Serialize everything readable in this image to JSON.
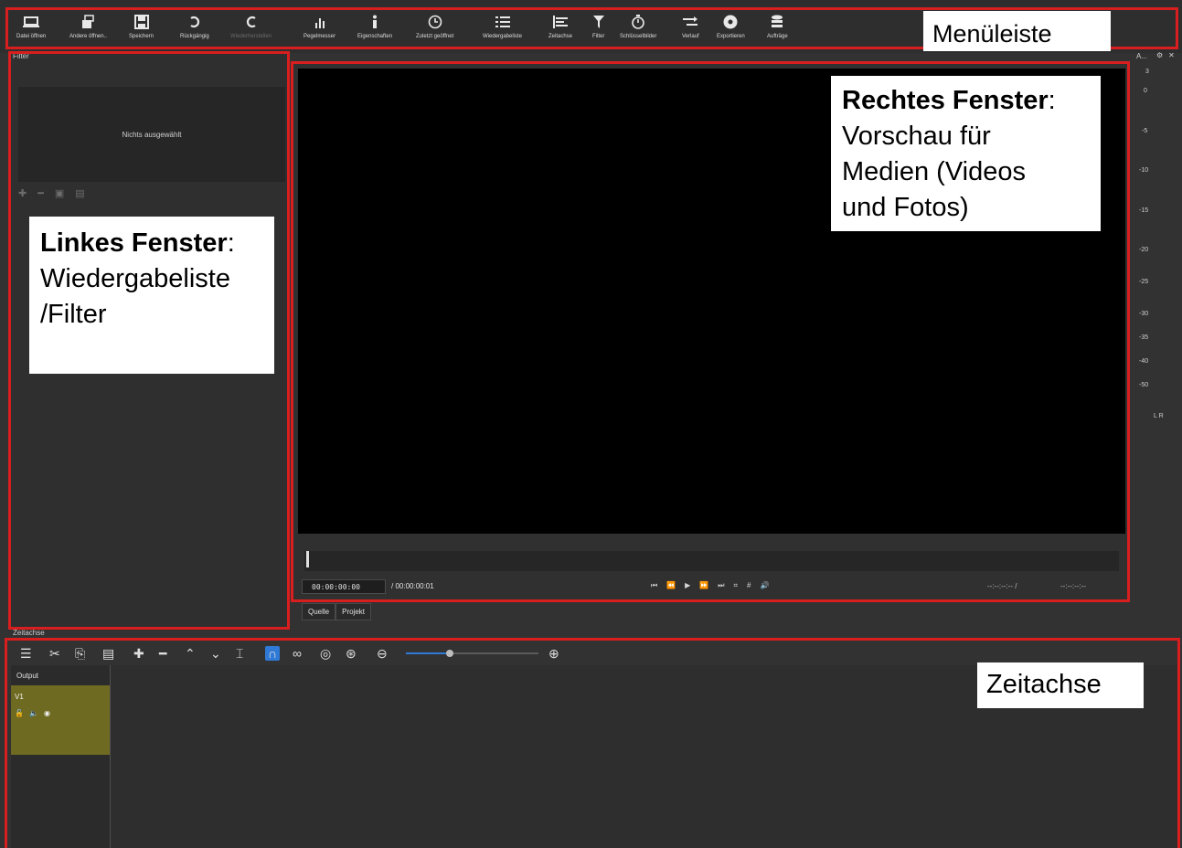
{
  "toolbar": {
    "items": [
      {
        "label": "Datei öffnen",
        "icon": "folder-open-icon"
      },
      {
        "label": "Andere öffnen..",
        "icon": "open-other-icon"
      },
      {
        "label": "Speichern",
        "icon": "save-icon"
      },
      {
        "label": "Rückgängig",
        "icon": "undo-icon"
      },
      {
        "label": "Wiederherstellen",
        "icon": "redo-icon",
        "disabled": true
      },
      {
        "label": "Pegelmesser",
        "icon": "meter-icon"
      },
      {
        "label": "Eigenschaften",
        "icon": "info-icon"
      },
      {
        "label": "Zuletzt geöffnet",
        "icon": "clock-icon"
      },
      {
        "label": "Wiedergabeliste",
        "icon": "list-icon"
      },
      {
        "label": "Zeitachse",
        "icon": "timeline-icon"
      },
      {
        "label": "Filter",
        "icon": "filter-icon"
      },
      {
        "label": "Schlüsselbilder",
        "icon": "stopwatch-icon"
      },
      {
        "label": "Verlauf",
        "icon": "history-icon"
      },
      {
        "label": "Exportieren",
        "icon": "export-icon"
      },
      {
        "label": "Aufträge",
        "icon": "jobs-icon"
      }
    ]
  },
  "annotations": {
    "menu": "Menüleiste",
    "left_bold": "Linkes Fenster",
    "left_colon": ":",
    "left_rest_1": "Wiedergabeliste",
    "left_rest_2": "/Filter",
    "right_bold": "Rechtes Fenster",
    "right_colon": ":",
    "right_rest_1": "Vorschau für",
    "right_rest_2": "Medien (Videos",
    "right_rest_3": "und Fotos)",
    "timeline": "Zeitachse"
  },
  "left_panel": {
    "title": "Filter",
    "empty_text": "Nichts ausgewählt"
  },
  "player": {
    "timecode": "00:00:00:00",
    "total": "/ 00:00:00:01",
    "in_point": "--:--:--:-- /",
    "out_point": "--:--:--:--",
    "tabs": [
      "Quelle",
      "Projekt"
    ]
  },
  "meter": {
    "title": "A...",
    "scale": [
      "3",
      "0",
      "-5",
      "-10",
      "-15",
      "-20",
      "-25",
      "-30",
      "-35",
      "-40",
      "-50"
    ],
    "channels": "L R"
  },
  "timeline": {
    "title": "Zeitachse",
    "output_label": "Output",
    "track_label": "V1"
  },
  "colors": {
    "annotation_red": "#d81e1e",
    "track_olive": "#6e6a21",
    "snap_blue": "#2f7ad6"
  }
}
